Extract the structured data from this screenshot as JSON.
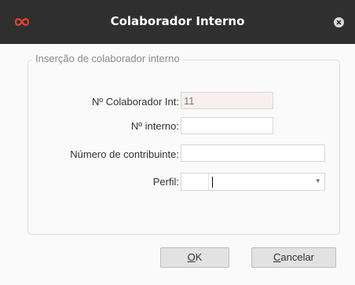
{
  "window": {
    "title": "Colaborador Interno"
  },
  "group": {
    "legend": "Inserção de colaborador interno"
  },
  "form": {
    "colaborador_int": {
      "label": "Nº Colaborador Int:",
      "value": "11"
    },
    "numero_interno": {
      "label": "Nº interno:",
      "value": ""
    },
    "contribuinte": {
      "label": "Número de contribuinte:",
      "value": ""
    },
    "perfil": {
      "label": "Perfil:",
      "value": ""
    }
  },
  "buttons": {
    "ok": {
      "mnemonic": "O",
      "rest": "K"
    },
    "cancel": {
      "mnemonic": "C",
      "rest": "ancelar"
    }
  },
  "icons": {
    "app": "infinity-icon",
    "close": "close-icon",
    "dropdown": "chevron-down-icon"
  },
  "colors": {
    "titlebar": "#2f2f2f",
    "app_icon": "#e8432a",
    "readonly_field": "#f7f0ef"
  }
}
